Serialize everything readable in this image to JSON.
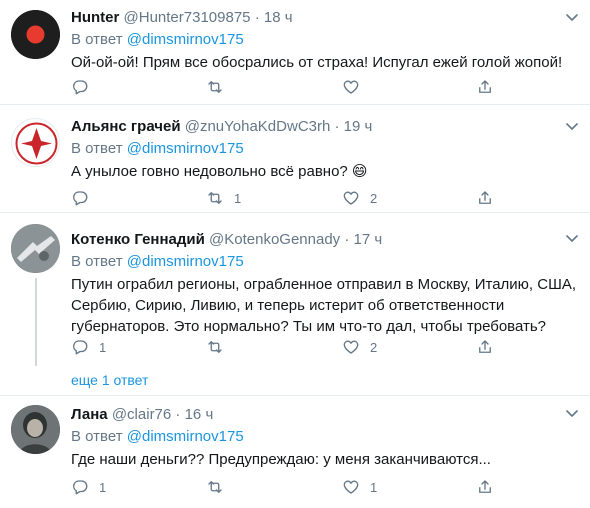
{
  "reply_prefix": "В ответ",
  "tweets": [
    {
      "name": "Hunter",
      "handle": "@Hunter73109875",
      "time": "18 ч",
      "reply_to": "@dimsmirnov175",
      "text": "Ой-ой-ой! Прям все обосрались от страха! Испугал ежей голой жопой!",
      "replies": "",
      "retweets": "",
      "likes": ""
    },
    {
      "name": "Альянс грачей",
      "handle": "@znuYohaKdDwC3rh",
      "time": "19 ч",
      "reply_to": "@dimsmirnov175",
      "text": "А унылое говно недовольно всё равно? 😄",
      "replies": "",
      "retweets": "1",
      "likes": "2"
    },
    {
      "name": "Котенко Геннадий",
      "handle": "@KotenkoGennady",
      "time": "17 ч",
      "reply_to": "@dimsmirnov175",
      "text": "Путин ограбил регионы, ограбленное отправил в Москву, Италию, США, Сербию, Сирию, Ливию, и теперь истерит об ответственности губернаторов. Это нормально? Ты им что-то дал, чтобы требовать?",
      "replies": "1",
      "retweets": "",
      "likes": "2"
    },
    {
      "name": "Лана",
      "handle": "@clair76",
      "time": "16 ч",
      "reply_to": "@dimsmirnov175",
      "text": "Где наши деньги?? Предупреждаю: у меня заканчиваются...",
      "replies": "1",
      "retweets": "",
      "likes": "1"
    }
  ],
  "show_more": "еще 1 ответ",
  "colors": {
    "accent": "#1b95e0",
    "muted": "#657786",
    "border": "#e6ecf0"
  },
  "icons": [
    "reply-icon",
    "retweet-icon",
    "like-icon",
    "share-icon",
    "chevron-down-icon"
  ]
}
